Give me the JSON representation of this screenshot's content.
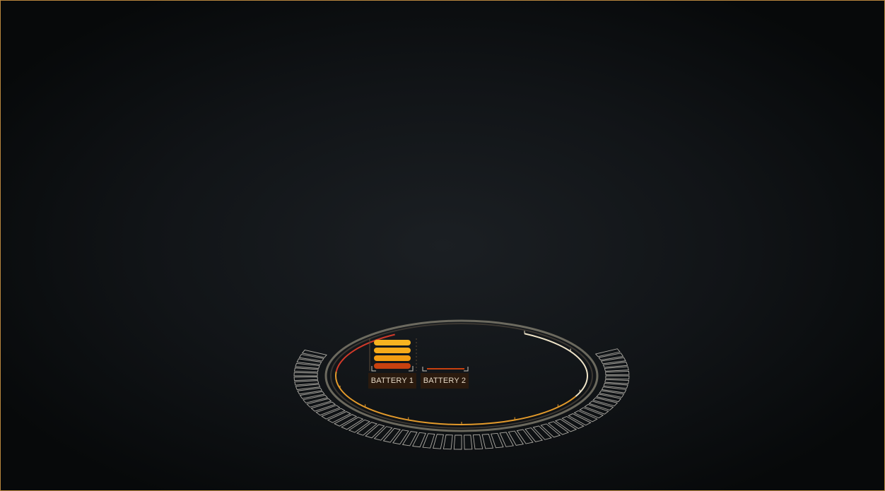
{
  "batteries": [
    {
      "label": "BATTERY 1",
      "level_bars": 5,
      "max_bars": 5
    },
    {
      "label": "BATTERY 2",
      "level_bars": 0,
      "max_bars": 5
    }
  ],
  "colors": {
    "frame_border": "#b8863e",
    "ring_outline": "#c9c6bd",
    "arc_orange": "#e39a2b",
    "arc_red": "#d23a2a",
    "arc_cream": "#efe4c8",
    "bar_top": "#f7b320",
    "bar_mid": "#f39c12",
    "bar_bottom": "#c8410f",
    "panel_bg": "#2a1a0e",
    "panel_text": "#e6d9c6"
  }
}
